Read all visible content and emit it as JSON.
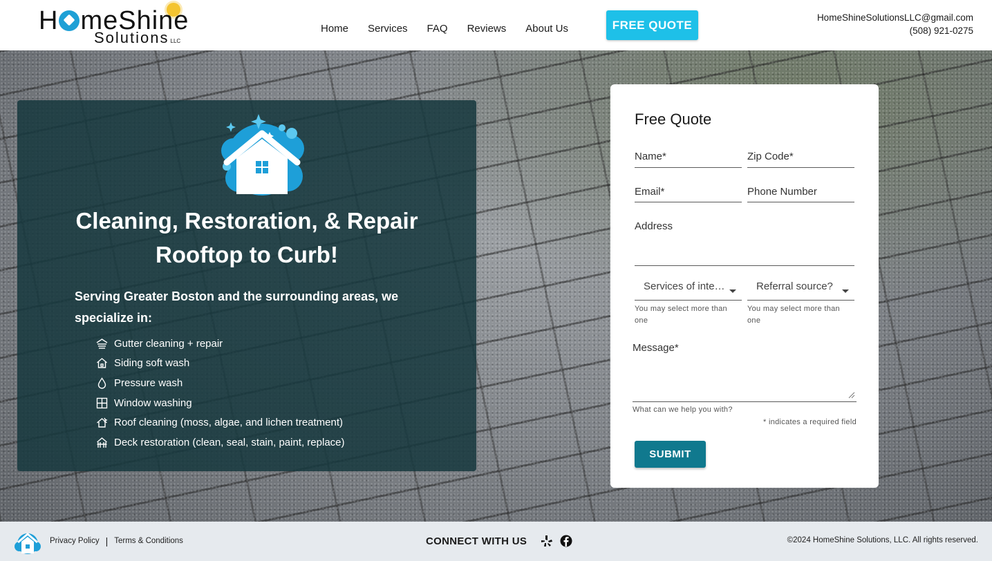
{
  "header": {
    "logo": {
      "main_prefix": "H",
      "main_suffix": "meShine",
      "sub": "Solutions",
      "llc": "LLC"
    },
    "nav": [
      "Home",
      "Services",
      "FAQ",
      "Reviews",
      "About Us"
    ],
    "quote_button": "FREE QUOTE",
    "email": "HomeShineSolutionsLLC@gmail.com",
    "phone": "(508) 921-0275"
  },
  "hero": {
    "headline_line1": "Cleaning, Restoration, & Repair",
    "headline_line2": "Rooftop to Curb!",
    "serving_text": "Serving Greater Boston and the surrounding areas, we specialize in:",
    "services": [
      {
        "icon": "gutter-icon",
        "label": "Gutter cleaning + repair"
      },
      {
        "icon": "house-icon",
        "label": "Siding soft wash"
      },
      {
        "icon": "droplet-icon",
        "label": "Pressure wash"
      },
      {
        "icon": "window-icon",
        "label": "Window washing"
      },
      {
        "icon": "roof-icon",
        "label": "Roof cleaning (moss, algae, and lichen treatment)"
      },
      {
        "icon": "deck-icon",
        "label": "Deck restoration (clean, seal, stain, paint, replace)"
      }
    ]
  },
  "form": {
    "title": "Free Quote",
    "name_label": "Name",
    "zip_label": "Zip Code",
    "email_label": "Email",
    "phone_label": "Phone Number",
    "address_label": "Address",
    "services_select": "Services of interest",
    "referral_select": "Referral source?",
    "multi_hint": "You may select more than one",
    "message_label": "Message",
    "message_hint": "What can we help you with?",
    "required_note": "* indicates a required field",
    "required_mark": "*",
    "submit_label": "SUBMIT"
  },
  "footer": {
    "privacy": "Privacy Policy",
    "separator": "|",
    "terms": "Terms & Conditions",
    "connect": "CONNECT WITH US",
    "social": [
      "yelp-icon",
      "facebook-icon"
    ],
    "copyright": "©2024 HomeShine Solutions, LLC. All rights reserved."
  },
  "colors": {
    "accent": "#1ec0e8",
    "panel": "#16383e",
    "submit": "#10798e",
    "logo_blue": "#1ea0d6"
  }
}
